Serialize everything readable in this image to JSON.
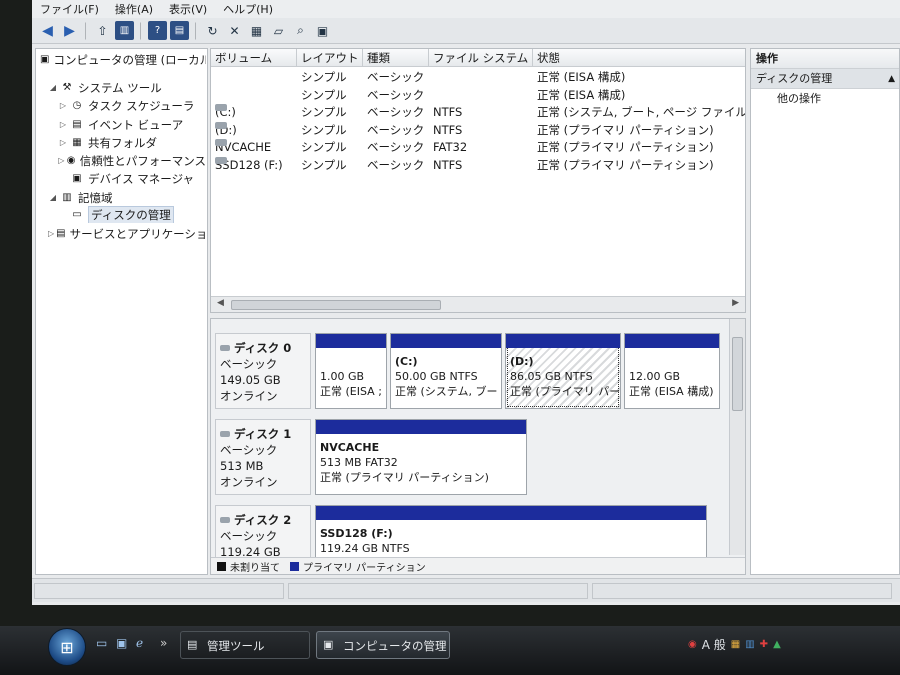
{
  "menu": [
    "ファイル(F)",
    "操作(A)",
    "表示(V)",
    "ヘルプ(H)"
  ],
  "tree": {
    "root": "コンピュータの管理 (ローカル)",
    "items": [
      {
        "label": "システム ツール",
        "indent": 1,
        "expander": "◢",
        "icon": "tools-icon",
        "glyph": "⚒"
      },
      {
        "label": "タスク スケジューラ",
        "indent": 2,
        "expander": "▷",
        "icon": "clock-icon",
        "glyph": "◷"
      },
      {
        "label": "イベント ビューア",
        "indent": 2,
        "expander": "▷",
        "icon": "event-viewer-icon",
        "glyph": "▤"
      },
      {
        "label": "共有フォルダ",
        "indent": 2,
        "expander": "▷",
        "icon": "shared-folder-icon",
        "glyph": "▦"
      },
      {
        "label": "信頼性とパフォーマンス",
        "indent": 2,
        "expander": "▷",
        "icon": "performance-icon",
        "glyph": "◉"
      },
      {
        "label": "デバイス マネージャ",
        "indent": 2,
        "expander": "",
        "icon": "device-manager-icon",
        "glyph": "▣"
      },
      {
        "label": "記憶域",
        "indent": 1,
        "expander": "◢",
        "icon": "storage-icon",
        "glyph": "▥"
      },
      {
        "label": "ディスクの管理",
        "indent": 2,
        "expander": "",
        "icon": "disk-management-icon",
        "glyph": "▭",
        "selected": true
      },
      {
        "label": "サービスとアプリケーション",
        "indent": 1,
        "expander": "▷",
        "icon": "services-icon",
        "glyph": "▤"
      }
    ]
  },
  "volumes": {
    "headers": [
      "ボリューム",
      "レイアウト",
      "種類",
      "ファイル システム",
      "状態"
    ],
    "rows": [
      {
        "volume": "",
        "layout": "シンプル",
        "type": "ベーシック",
        "fs": "",
        "status": "正常 (EISA 構成)"
      },
      {
        "volume": "",
        "layout": "シンプル",
        "type": "ベーシック",
        "fs": "",
        "status": "正常 (EISA 構成)"
      },
      {
        "volume": "(C:)",
        "layout": "シンプル",
        "type": "ベーシック",
        "fs": "NTFS",
        "status": "正常 (システム, ブート, ページ ファイル, ア"
      },
      {
        "volume": "(D:)",
        "layout": "シンプル",
        "type": "ベーシック",
        "fs": "NTFS",
        "status": "正常 (プライマリ パーティション)"
      },
      {
        "volume": "NVCACHE",
        "layout": "シンプル",
        "type": "ベーシック",
        "fs": "FAT32",
        "status": "正常 (プライマリ パーティション)"
      },
      {
        "volume": "SSD128 (F:)",
        "layout": "シンプル",
        "type": "ベーシック",
        "fs": "NTFS",
        "status": "正常 (プライマリ パーティション)"
      }
    ]
  },
  "disks": [
    {
      "name": "ディスク 0",
      "type": "ベーシック",
      "size": "149.05 GB",
      "state": "オンライン",
      "partitions": [
        {
          "name": "",
          "size": "1.00 GB",
          "status": "正常 (EISA ;"
        },
        {
          "name": "(C:)",
          "size": "50.00 GB NTFS",
          "status": "正常 (システム, ブー"
        },
        {
          "name": "(D:)",
          "size": "86.05 GB NTFS",
          "status": "正常 (プライマリ パー",
          "selected": true
        },
        {
          "name": "",
          "size": "12.00 GB",
          "status": "正常 (EISA 構成)"
        }
      ]
    },
    {
      "name": "ディスク 1",
      "type": "ベーシック",
      "size": "513 MB",
      "state": "オンライン",
      "partitions": [
        {
          "name": "NVCACHE",
          "size": "513 MB FAT32",
          "status": "正常 (プライマリ パーティション)"
        }
      ]
    },
    {
      "name": "ディスク 2",
      "type": "ベーシック",
      "size": "119.24 GB",
      "state": "",
      "partitions": [
        {
          "name": "SSD128 (F:)",
          "size": "119.24 GB NTFS",
          "status": ""
        }
      ]
    }
  ],
  "legend": [
    {
      "label": "未割り当て",
      "color": "#111111"
    },
    {
      "label": "プライマリ パーティション",
      "color": "#1c2c9c"
    }
  ],
  "actions": {
    "header": "操作",
    "section": "ディスクの管理",
    "item": "他の操作"
  },
  "taskbar": {
    "tasks": [
      "管理ツール",
      "コンピュータの管理"
    ],
    "tray_ime": "A 般"
  },
  "colors": {
    "partition_bar": "#1c2c9c",
    "selection": "#dfe7f1"
  }
}
